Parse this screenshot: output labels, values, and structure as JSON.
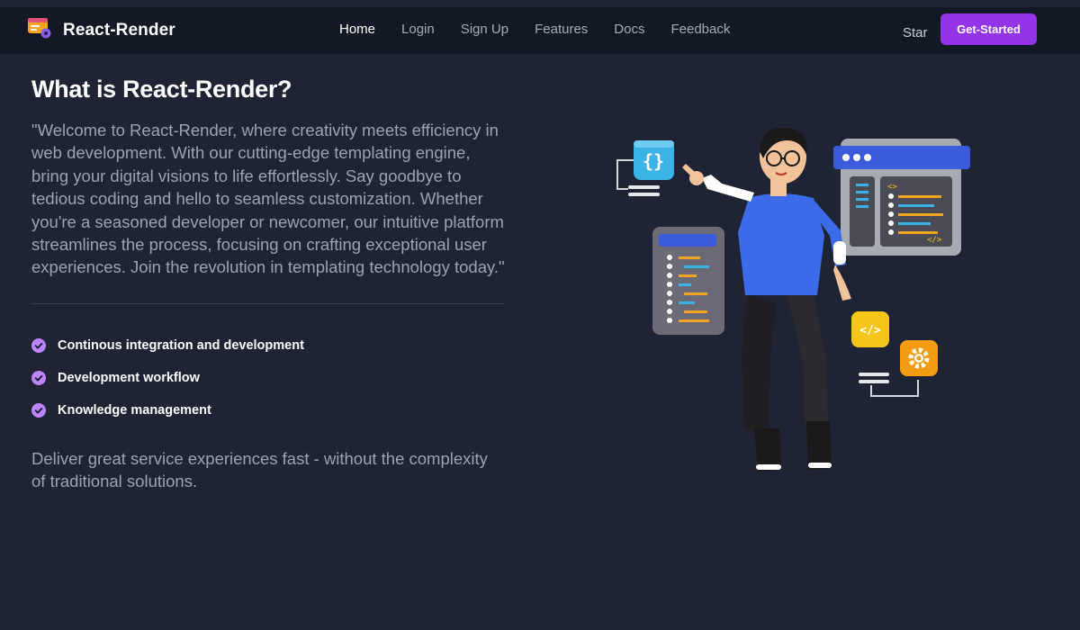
{
  "brand": {
    "name": "React-Render"
  },
  "nav": {
    "links": [
      {
        "label": "Home",
        "active": true
      },
      {
        "label": "Login"
      },
      {
        "label": "Sign Up"
      },
      {
        "label": "Features"
      },
      {
        "label": "Docs"
      },
      {
        "label": "Feedback"
      }
    ],
    "star_label": "Star",
    "cta_label": "Get-Started"
  },
  "hero": {
    "title": "What is React-Render?",
    "intro": "\"Welcome to React-Render, where creativity meets efficiency in web development. With our cutting-edge templating engine, bring your digital visions to life effortlessly. Say goodbye to tedious coding and hello to seamless customization. Whether you're a seasoned developer or newcomer, our intuitive platform streamlines the process, focusing on crafting exceptional user experiences. Join the revolution in templating technology today.\"",
    "features": [
      {
        "label": "Continous integration and development",
        "icon": "check-circle-icon"
      },
      {
        "label": "Development workflow",
        "icon": "check-circle-icon"
      },
      {
        "label": "Knowledge management",
        "icon": "check-circle-icon"
      }
    ],
    "tagline": "Deliver great service experiences fast - without the complexity of traditional solutions."
  },
  "colors": {
    "background": "#1e2433",
    "navbar": "#131924",
    "accent": "#9333ea",
    "check": "#c084fc",
    "body_text": "#9ba3ae"
  },
  "icons": {
    "logo": "logo-icon",
    "illustration": "developer-illustration"
  }
}
